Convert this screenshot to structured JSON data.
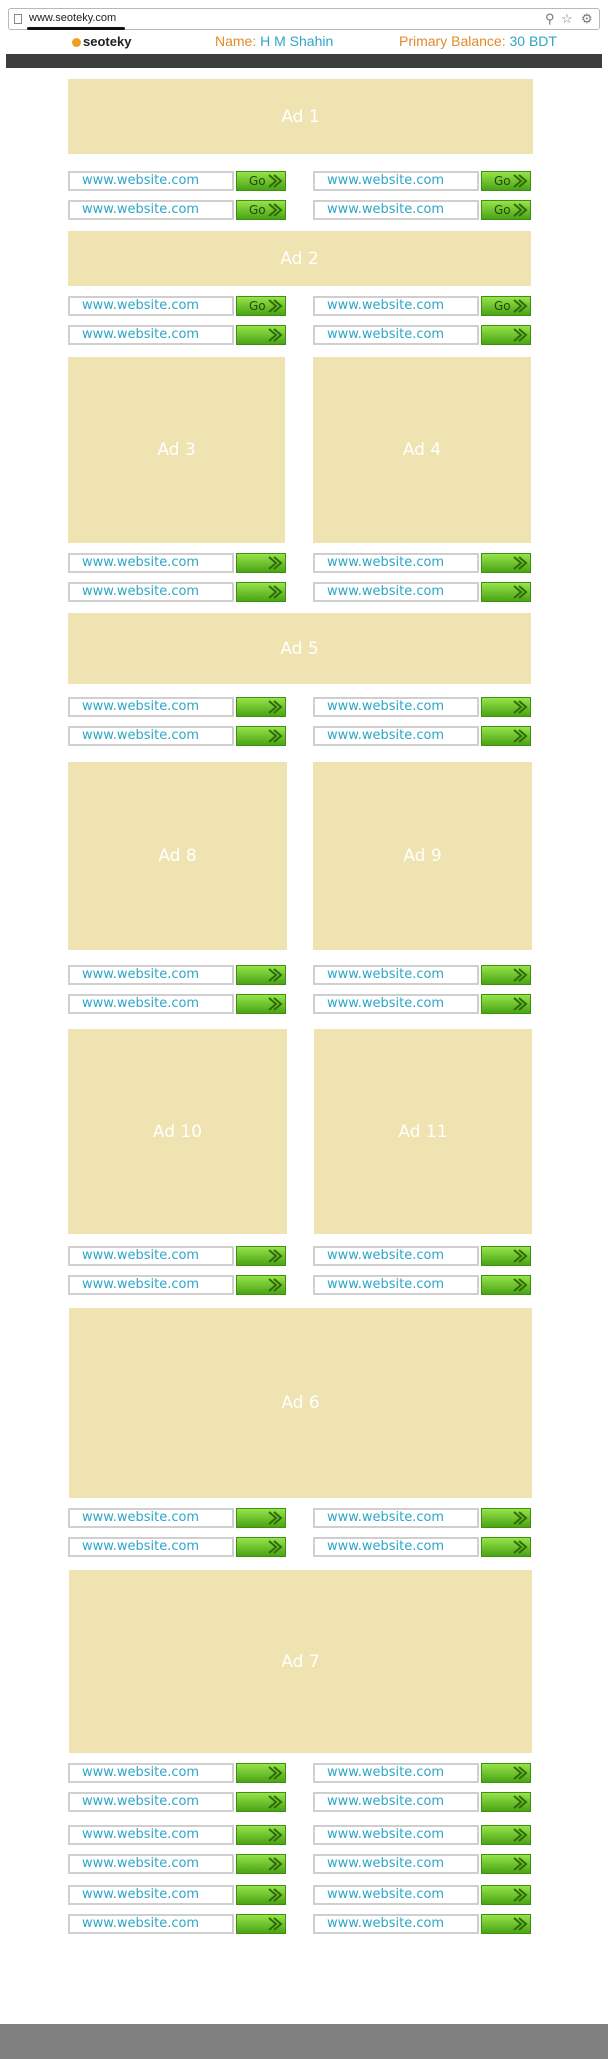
{
  "browser": {
    "url": "www.seoteky.com"
  },
  "header": {
    "logo": "seoteky",
    "name_label": "Name:",
    "name_value": "H M Shahin",
    "balance_label": "Primary Balance:",
    "balance_value": "30 BDT"
  },
  "colors": {
    "ad_bg": "#efe3b2",
    "link_text": "#2ea6c6",
    "label_orange": "#e38b2a",
    "button_green": "#5fbf1c"
  },
  "ads": [
    "Ad 1",
    "Ad 2",
    "Ad 3",
    "Ad 4",
    "Ad 5",
    "Ad 8",
    "Ad 9",
    "Ad 10",
    "Ad 11",
    "Ad 6",
    "Ad 7"
  ],
  "link_text": "www.website.com",
  "go_label": "Go"
}
